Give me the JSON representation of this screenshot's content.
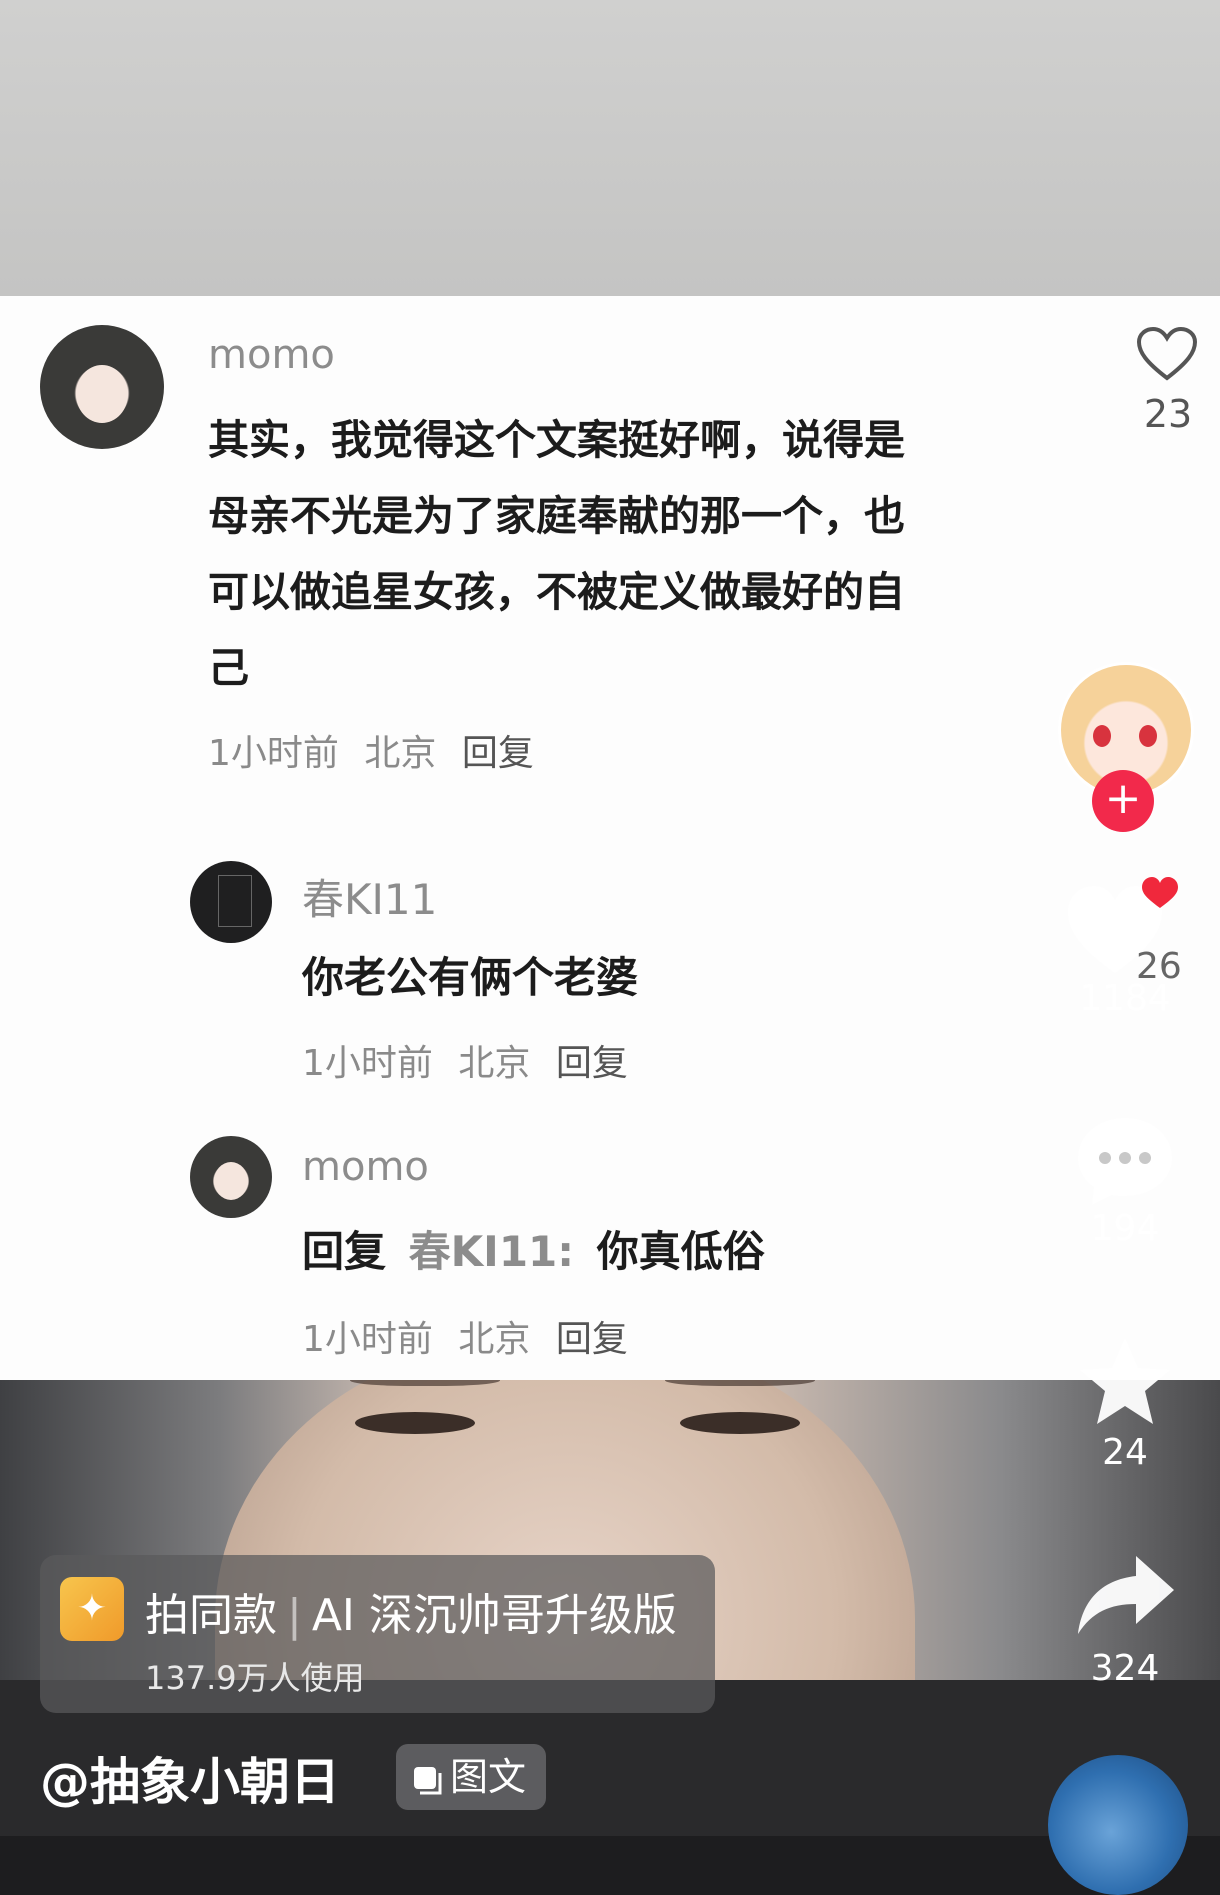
{
  "comments": {
    "main": {
      "username": "momo",
      "text_lines": [
        "其实，我觉得这个文案挺好啊，说得是",
        "母亲不光是为了家庭奉献的那一个，也",
        "可以做追星女孩，不被定义做最好的自",
        "己"
      ],
      "time": "1小时前",
      "location": "北京",
      "reply_label": "回复",
      "like_count": "23"
    },
    "reply1": {
      "username": "春KI11",
      "text": "你老公有俩个老婆",
      "time": "1小时前",
      "location": "北京",
      "reply_label": "回复"
    },
    "reply2": {
      "username": "momo",
      "reply_prefix": "回复",
      "reply_to": "春KI11:",
      "text": "你真低俗",
      "time": "1小时前",
      "location": "北京",
      "reply_label": "回复"
    }
  },
  "sidebar": {
    "follow_icon": "plus-icon",
    "like_count": "1184",
    "like_count_overlap": "26",
    "comment_count": "194",
    "favorite_count": "24",
    "share_count": "324"
  },
  "template_chip": {
    "title": "拍同款",
    "separator": "|",
    "effect_name": "AI 深沉帅哥升级版",
    "usage": "137.9万人使用"
  },
  "author": {
    "handle": "@抽象小朝日",
    "tag_label": "图文"
  },
  "colors": {
    "like_red": "#f0283c",
    "follow_red": "#f2294b",
    "chip_icon": "#f4b23c"
  }
}
